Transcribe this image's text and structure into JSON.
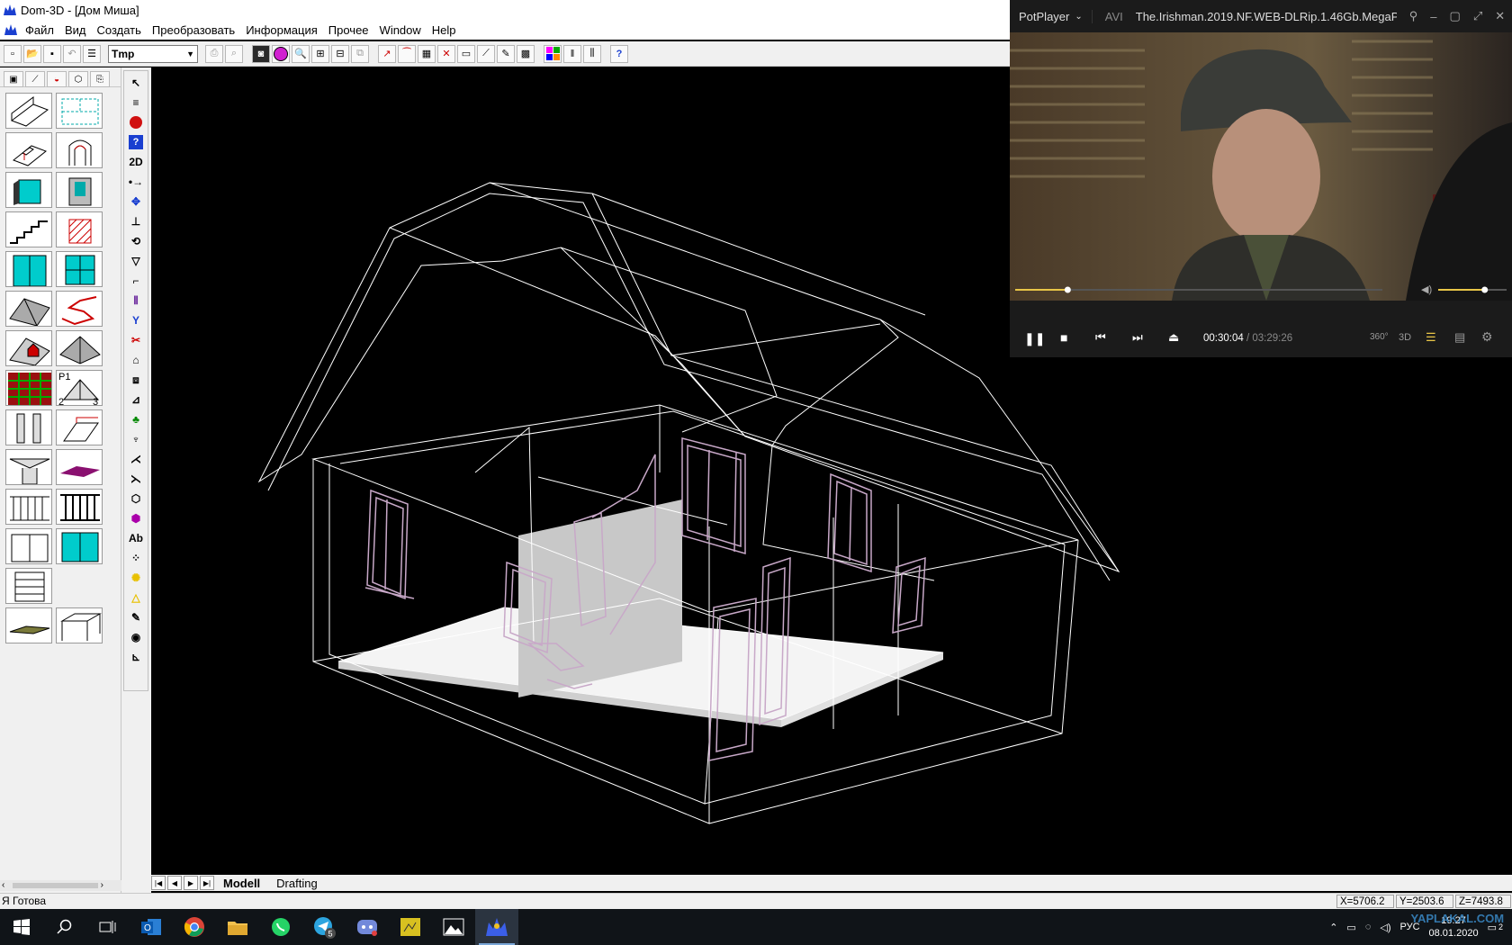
{
  "app": {
    "title": "Dom-3D - [Дом Миша]",
    "menu": [
      "Файл",
      "Вид",
      "Создать",
      "Преобразовать",
      "Информация",
      "Прочее",
      "Window",
      "Help"
    ],
    "layer_value": "Tmp",
    "help_label": "?"
  },
  "vtools": {
    "two_d_label": "2D",
    "text_tool_label": "Ab"
  },
  "palette": {
    "roof_points_label": "P1",
    "roof_point_2": "2",
    "roof_point_3": "3"
  },
  "sheets": [
    "Modell",
    "Drafting"
  ],
  "status": {
    "text": "Я Готова",
    "x": "X=5706.2",
    "y": "Y=2503.6",
    "z": "Z=7493.8"
  },
  "player": {
    "name": "PotPlayer",
    "format": "AVI",
    "file": "The.Irishman.2019.NF.WEB-DLRip.1.46Gb.MegaP",
    "time_current": "00:30:04",
    "time_sep": "/",
    "time_total": "03:29:26",
    "progress": 0.143,
    "volume": 0.68,
    "label_360": "360°",
    "label_3d": "3D"
  },
  "taskbar": {
    "lang": "РУС",
    "time": "19:27",
    "date": "08.01.2020",
    "notif": "2",
    "telegram_badge": "5",
    "watermark": "YAPLAKAL.COM"
  },
  "colors": {
    "wire_white": "#ffffff",
    "wire_pink": "#c8a8c8",
    "floor": "#f4f4f4",
    "accent_player": "#e8c547"
  }
}
